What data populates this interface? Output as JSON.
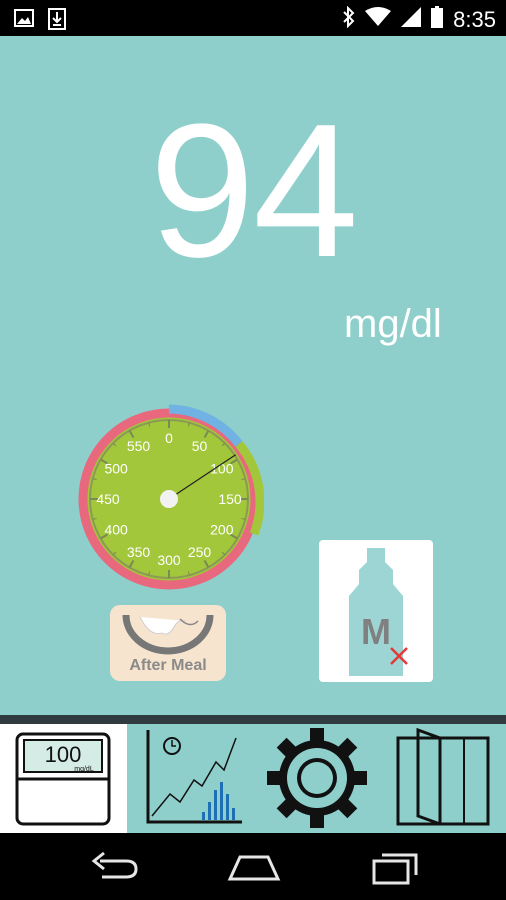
{
  "status_bar": {
    "time": "8:35",
    "icons": [
      "image-icon",
      "download-icon",
      "bluetooth-icon",
      "wifi-icon",
      "signal-icon",
      "battery-icon"
    ]
  },
  "reading": {
    "value": "94",
    "unit": "mg/dl"
  },
  "gauge": {
    "tick_labels": [
      "0",
      "50",
      "100",
      "150",
      "200",
      "250",
      "300",
      "350",
      "400",
      "450",
      "500",
      "550"
    ],
    "needle_value": 94,
    "colors": {
      "face": "#a2c73a",
      "normal_arc": "#a2c73a",
      "high_arc": "#e8697e",
      "low_arc": "#6fb2e3"
    }
  },
  "meal_context": {
    "label": "After Meal"
  },
  "strip_indicator": {
    "letter": "M"
  },
  "bottom_nav": {
    "tabs": [
      {
        "name": "meter",
        "reading_value": "100",
        "reading_unit": "mg/dL",
        "active": true
      },
      {
        "name": "history-chart",
        "active": false
      },
      {
        "name": "settings",
        "active": false
      },
      {
        "name": "logbook",
        "active": false
      }
    ]
  },
  "system_nav": {
    "buttons": [
      "back-icon",
      "home-icon",
      "recent-apps-icon"
    ]
  },
  "colors": {
    "background": "#8ecfcc",
    "text": "#ffffff",
    "meal_tile": "#f7e4cf"
  }
}
